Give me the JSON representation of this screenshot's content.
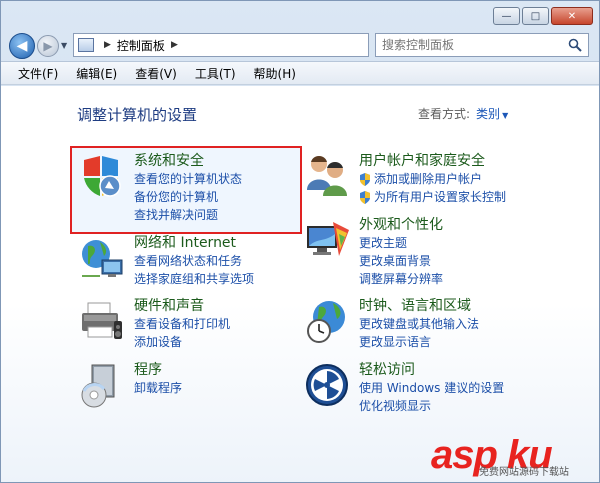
{
  "window": {
    "caption_min": "—",
    "caption_max": "□",
    "caption_close": "✕"
  },
  "nav": {
    "back_glyph": "◀",
    "forward_glyph": "▶",
    "address_path": "控制面板",
    "search_placeholder": "搜索控制面板"
  },
  "menu": [
    "文件(F)",
    "编辑(E)",
    "查看(V)",
    "工具(T)",
    "帮助(H)"
  ],
  "content": {
    "title": "调整计算机的设置",
    "view_by_label": "查看方式:",
    "view_by_value": "类别"
  },
  "categories": [
    {
      "title": "系统和安全",
      "icon": "shield-icon",
      "links": [
        "查看您的计算机状态",
        "备份您的计算机",
        "查找并解决问题"
      ]
    },
    {
      "title": "网络和 Internet",
      "icon": "network-icon",
      "links": [
        "查看网络状态和任务",
        "选择家庭组和共享选项"
      ]
    },
    {
      "title": "硬件和声音",
      "icon": "printer-icon",
      "links": [
        "查看设备和打印机",
        "添加设备"
      ]
    },
    {
      "title": "程序",
      "icon": "programs-icon",
      "links": [
        "卸载程序"
      ]
    },
    {
      "title": "用户帐户和家庭安全",
      "icon": "users-icon",
      "links": [
        "添加或删除用户帐户",
        "为所有用户设置家长控制"
      ]
    },
    {
      "title": "外观和个性化",
      "icon": "monitor-icon",
      "links": [
        "更改主题",
        "更改桌面背景",
        "调整屏幕分辨率"
      ]
    },
    {
      "title": "时钟、语言和区域",
      "icon": "globe-clock-icon",
      "links": [
        "更改键盘或其他输入法",
        "更改显示语言"
      ]
    },
    {
      "title": "轻松访问",
      "icon": "ease-of-access-icon",
      "links": [
        "使用 Windows 建议的设置",
        "优化视频显示"
      ]
    }
  ],
  "watermark": {
    "logo": "asp ku",
    "sub": "免费网站源码下载站"
  },
  "colors": {
    "title_blue": "#1e3c82",
    "category_green": "#1b5a1b",
    "link_blue": "#1c4fa8",
    "highlight_red": "#e02222"
  }
}
